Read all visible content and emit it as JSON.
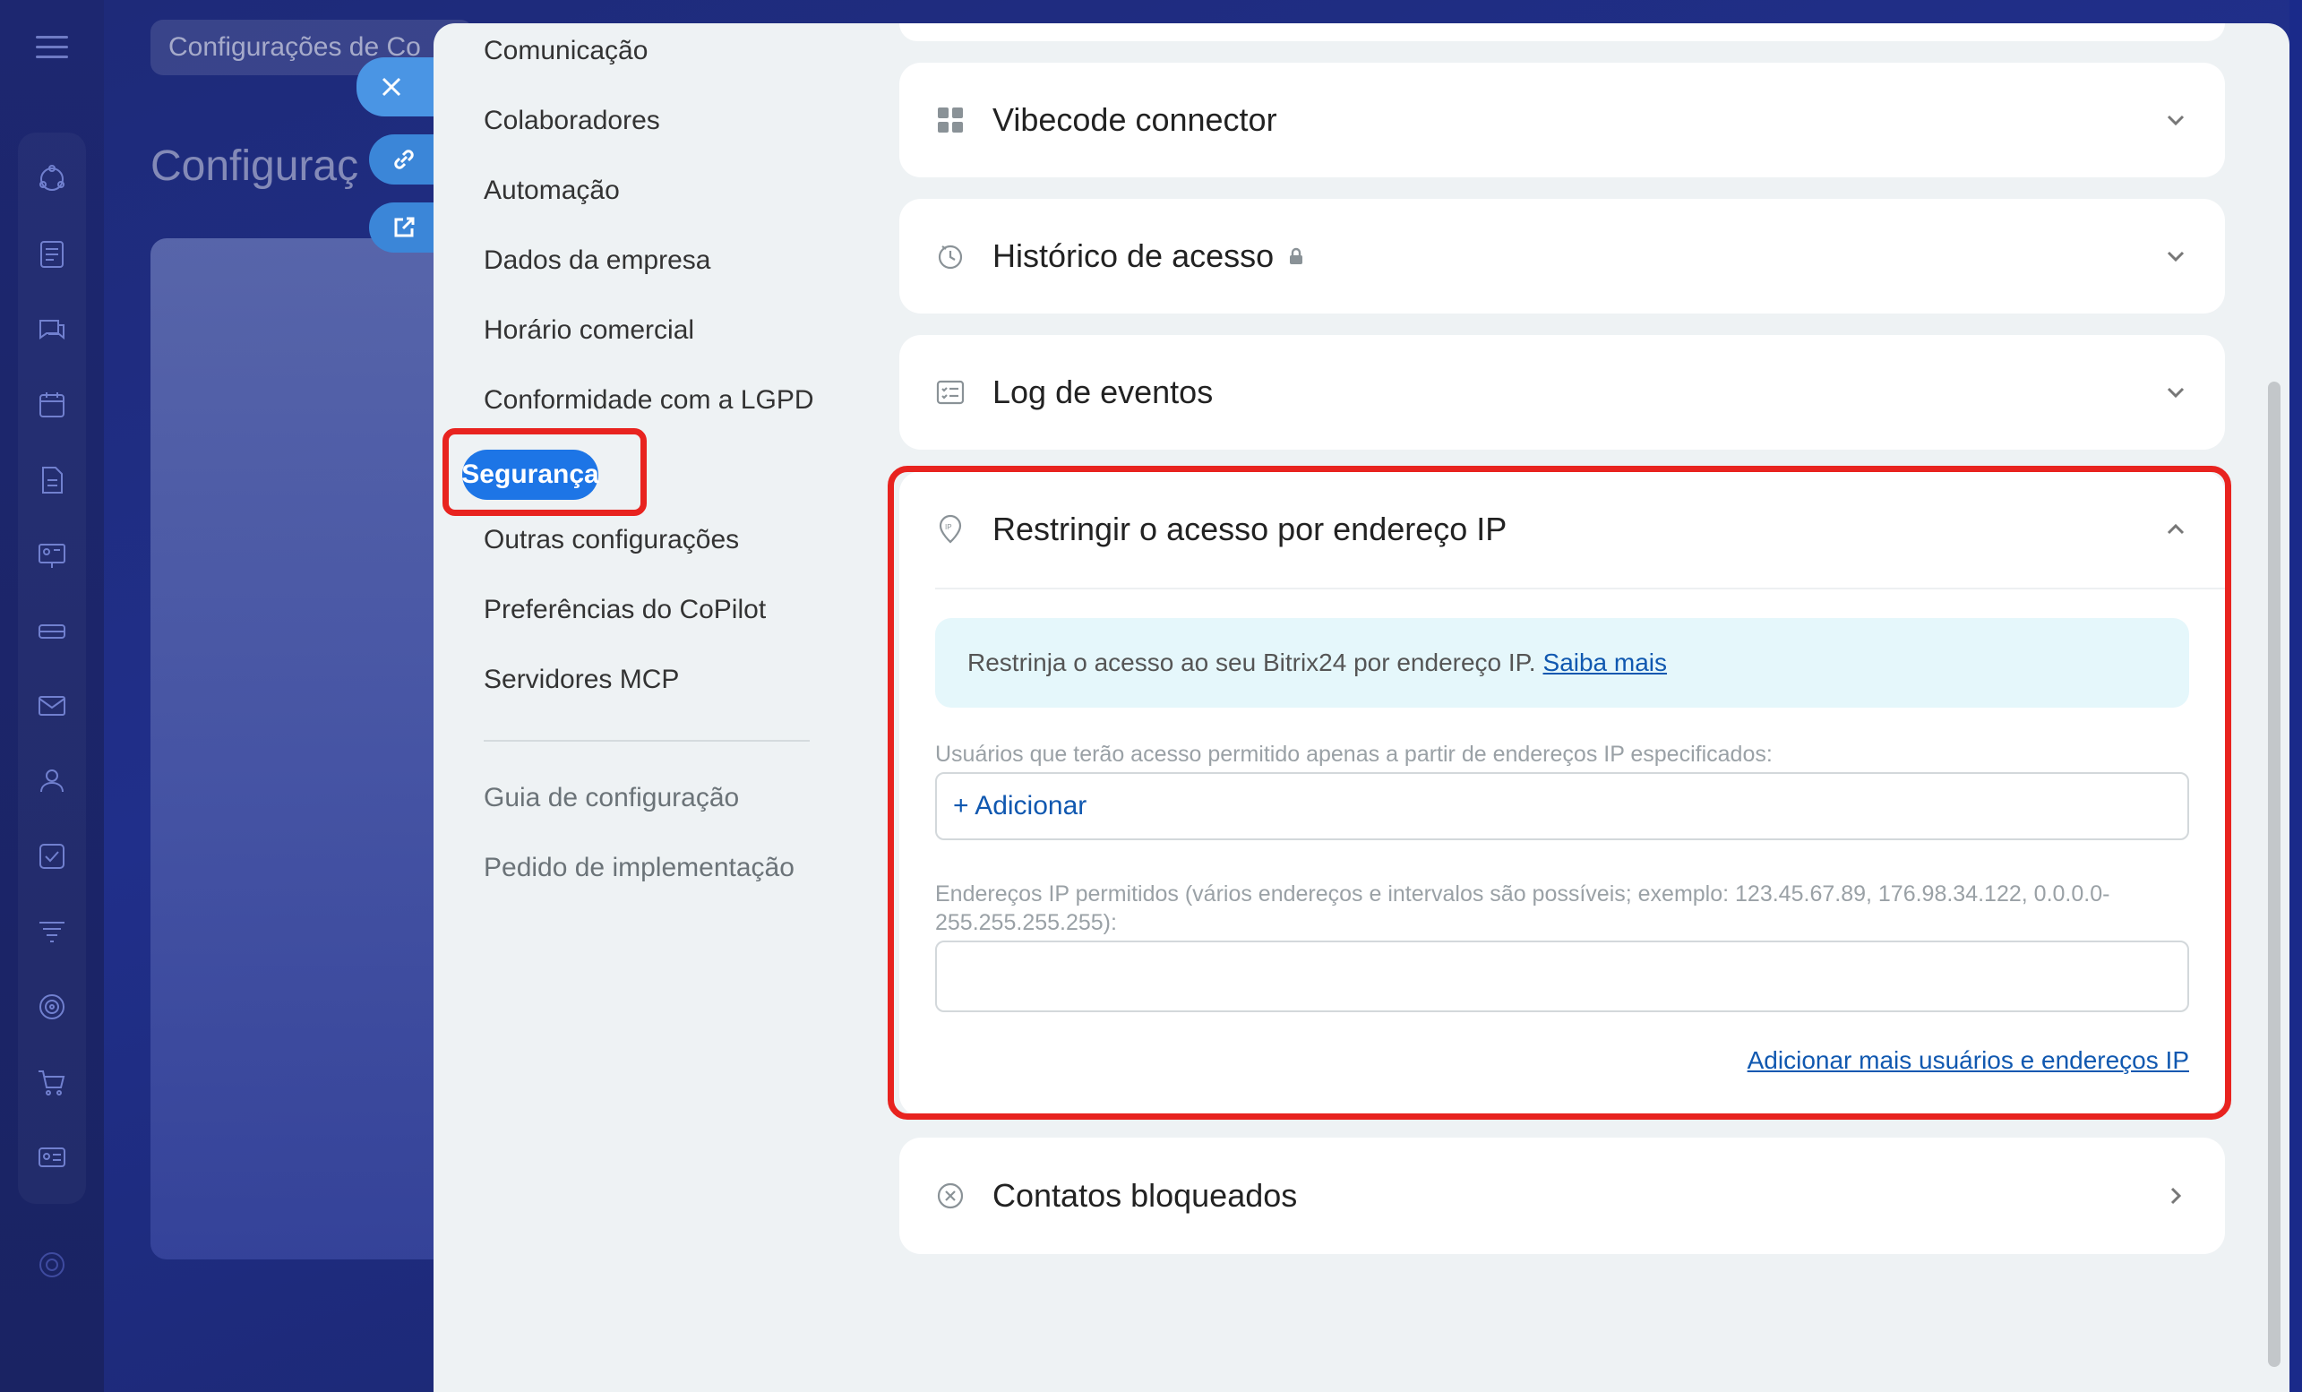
{
  "background": {
    "header_pill": "Configurações de Co",
    "title": "Configuraç"
  },
  "menu": {
    "items": [
      "Comunicação",
      "Colaboradores",
      "Automação",
      "Dados da empresa",
      "Horário comercial",
      "Conformidade com a LGPD",
      "Segurança",
      "Outras configurações",
      "Preferências do CoPilot",
      "Servidores MCP"
    ],
    "active": "Segurança",
    "secondary": [
      "Guia de configuração",
      "Pedido de implementação"
    ]
  },
  "cards": {
    "vibecode": "Vibecode connector",
    "historico": "Histórico de acesso",
    "log": "Log de eventos",
    "ip": "Restringir o acesso por endereço IP",
    "bloqueados": "Contatos bloqueados"
  },
  "ip_section": {
    "info_text": "Restrinja o acesso ao seu Bitrix24 por endereço IP.",
    "info_link": "Saiba mais",
    "users_label": "Usuários que terão acesso permitido apenas a partir de endereços IP especificados:",
    "add_label": "+ Adicionar",
    "ips_label": "Endereços IP permitidos (vários endereços e intervalos são possíveis; exemplo: 123.45.67.89, 176.98.34.122, 0.0.0.0-255.255.255.255):",
    "ips_value": "",
    "more_link": "Adicionar mais usuários e endereços IP"
  },
  "colors": {
    "accent": "#1d75e6",
    "link": "#1058b0",
    "highlight": "#e8231f",
    "info_bg": "#e5f7fb"
  }
}
